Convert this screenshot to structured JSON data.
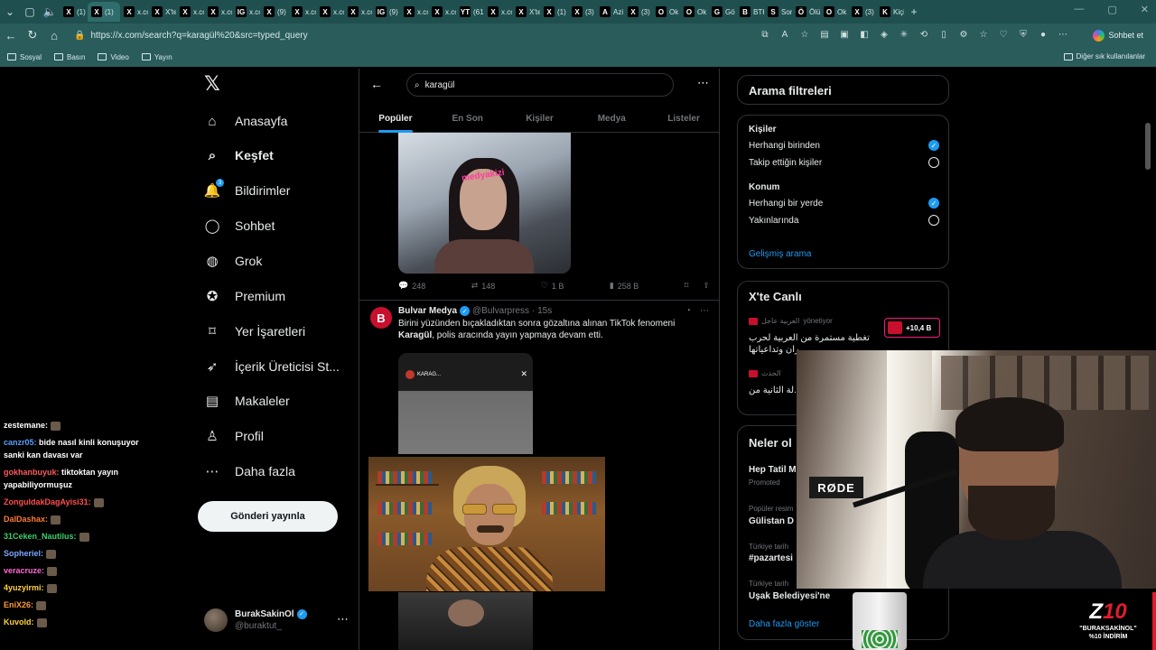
{
  "browser": {
    "tabs": [
      {
        "favicon": "X",
        "label": "(1)"
      },
      {
        "favicon": "X",
        "label": "(1)"
      },
      {
        "favicon": "X",
        "label": "x.co"
      },
      {
        "favicon": "X",
        "label": "X'te"
      },
      {
        "favicon": "X",
        "label": "x.co"
      },
      {
        "favicon": "X",
        "label": "x.co"
      },
      {
        "favicon": "IG",
        "label": "x.co"
      },
      {
        "favicon": "X",
        "label": "(9)"
      },
      {
        "favicon": "X",
        "label": "x.co"
      },
      {
        "favicon": "X",
        "label": "x.co"
      },
      {
        "favicon": "X",
        "label": "x.co"
      },
      {
        "favicon": "IG",
        "label": "(9)"
      },
      {
        "favicon": "X",
        "label": "x.co"
      },
      {
        "favicon": "X",
        "label": "x.co"
      },
      {
        "favicon": "YT",
        "label": "(61"
      },
      {
        "favicon": "X",
        "label": "x.co"
      },
      {
        "favicon": "X",
        "label": "X'te"
      },
      {
        "favicon": "X",
        "label": "(1)"
      },
      {
        "favicon": "X",
        "label": "(3)"
      },
      {
        "favicon": "A",
        "label": "Azi"
      },
      {
        "favicon": "X",
        "label": "(3)"
      },
      {
        "favicon": "O",
        "label": "Ok"
      },
      {
        "favicon": "O",
        "label": "Ok"
      },
      {
        "favicon": "G",
        "label": "Gö"
      },
      {
        "favicon": "B",
        "label": "BTK"
      },
      {
        "favicon": "S",
        "label": "Sor"
      },
      {
        "favicon": "Ö",
        "label": "Ölü"
      },
      {
        "favicon": "O",
        "label": "Ok"
      },
      {
        "favicon": "X",
        "label": "(3)"
      },
      {
        "favicon": "K",
        "label": "Kiçi"
      }
    ],
    "active_tab_index": 1,
    "url": "https://x.com/search?q=karagül%20&src=typed_query",
    "chat_button": "Sohbet et",
    "bookmarks": [
      "Sosyal",
      "Basın",
      "Video",
      "Yayın"
    ],
    "other_bookmarks": "Diğer sık kullanılanlar"
  },
  "nav": {
    "items": [
      {
        "label": "Anasayfa",
        "icon": "home-icon"
      },
      {
        "label": "Keşfet",
        "icon": "search-icon"
      },
      {
        "label": "Bildirimler",
        "icon": "bell-icon"
      },
      {
        "label": "Sohbet",
        "icon": "chat-icon"
      },
      {
        "label": "Grok",
        "icon": "grok-icon"
      },
      {
        "label": "Premium",
        "icon": "premium-icon"
      },
      {
        "label": "Yer İşaretleri",
        "icon": "bookmark-icon"
      },
      {
        "label": "İçerik Üreticisi St...",
        "icon": "rocket-icon"
      },
      {
        "label": "Makaleler",
        "icon": "article-icon"
      },
      {
        "label": "Profil",
        "icon": "person-icon"
      },
      {
        "label": "Daha fazla",
        "icon": "more-circle-icon"
      }
    ],
    "notification_badge": "3",
    "post_button": "Gönderi yayınla",
    "profile": {
      "name": "BurakSakinOl",
      "handle": "@buraktut_"
    }
  },
  "chat": [
    {
      "user": "zestemane:",
      "text": "",
      "color": "#ffffff"
    },
    {
      "user": "canzr05:",
      "text": "bide nasıl kinli konuşuyor sanki kan davası var",
      "color": "#5aa0ff"
    },
    {
      "user": "gokhanbuyuk:",
      "text": "tiktoktan yayın yapabiliyormuşuz",
      "color": "#ff5a5a"
    },
    {
      "user": "ZonguldakDagAyisi31:",
      "text": "",
      "color": "#ff4d4d"
    },
    {
      "user": "DalDashax:",
      "text": "",
      "color": "#ff7a3a"
    },
    {
      "user": "31Ceken_Nautilus:",
      "text": "",
      "color": "#3ad16a"
    },
    {
      "user": "Sopheriel:",
      "text": "",
      "color": "#7aa8ff"
    },
    {
      "user": "veracruze:",
      "text": "",
      "color": "#ff6ad5"
    },
    {
      "user": "4yuzyirmi:",
      "text": "",
      "color": "#ffd23a"
    },
    {
      "user": "EniX26:",
      "text": "",
      "color": "#ff9a3a"
    },
    {
      "user": "Kuvold:",
      "text": "",
      "color": "#ffd23a"
    }
  ],
  "search": {
    "query": "karagül",
    "tabs": [
      "Popüler",
      "En Son",
      "Kişiler",
      "Medya",
      "Listeler"
    ],
    "active_tab": "Popüler"
  },
  "tweet1": {
    "watermark": "medyakizi",
    "replies": "248",
    "reposts": "148",
    "likes": "1 B",
    "views": "258 B"
  },
  "tweet2": {
    "author": "Bulvar Medya",
    "handle": "@Bulvarpress",
    "time": "· 15s",
    "text_pre": "Birini yüzünden bıçakladıktan sonra gözaltına alınan TikTok fenomeni",
    "text_bold": "Karagül",
    "text_post": ", polis aracında yayın yapmaya devam etti.",
    "media_label": "KARAG..."
  },
  "filters": {
    "title": "Arama filtreleri",
    "people_title": "Kişiler",
    "people_opts": [
      "Herhangi birinden",
      "Takip ettiğin kişiler"
    ],
    "location_title": "Konum",
    "location_opts": [
      "Herhangi bir yerde",
      "Yakınlarında"
    ],
    "advanced": "Gelişmiş arama"
  },
  "live": {
    "title": "X'te Canlı",
    "item1_source": "العربية عاجل",
    "item1_role": "yönetiyor",
    "item1_text": "تغطية مستمرة من العربية لحرب ...ران وتداعياتها",
    "item1_count": "+10,4 B",
    "item2_source": "الحدث",
    "item2_text": "طهران ترفض ...لة الثانية من"
  },
  "trends": {
    "title": "Neler ol",
    "items": [
      {
        "small": "",
        "big": "Hep Tatil M"
      },
      {
        "small": "Promoted",
        "big": ""
      },
      {
        "small": "Popüler resim",
        "big": "Gülistan D"
      },
      {
        "small": "Türkiye tarih",
        "big": "#pazartesi"
      },
      {
        "small": "Türkiye tarih",
        "big": "Uşak Belediyesi'ne"
      }
    ],
    "show_more": "Daha fazla göster"
  },
  "stream": {
    "mic_brand": "RØDE",
    "brand_logo": "Z",
    "brand_sub1": "\"BURAKSAKİNOL\"",
    "brand_sub2": "%10 İNDİRİM"
  }
}
